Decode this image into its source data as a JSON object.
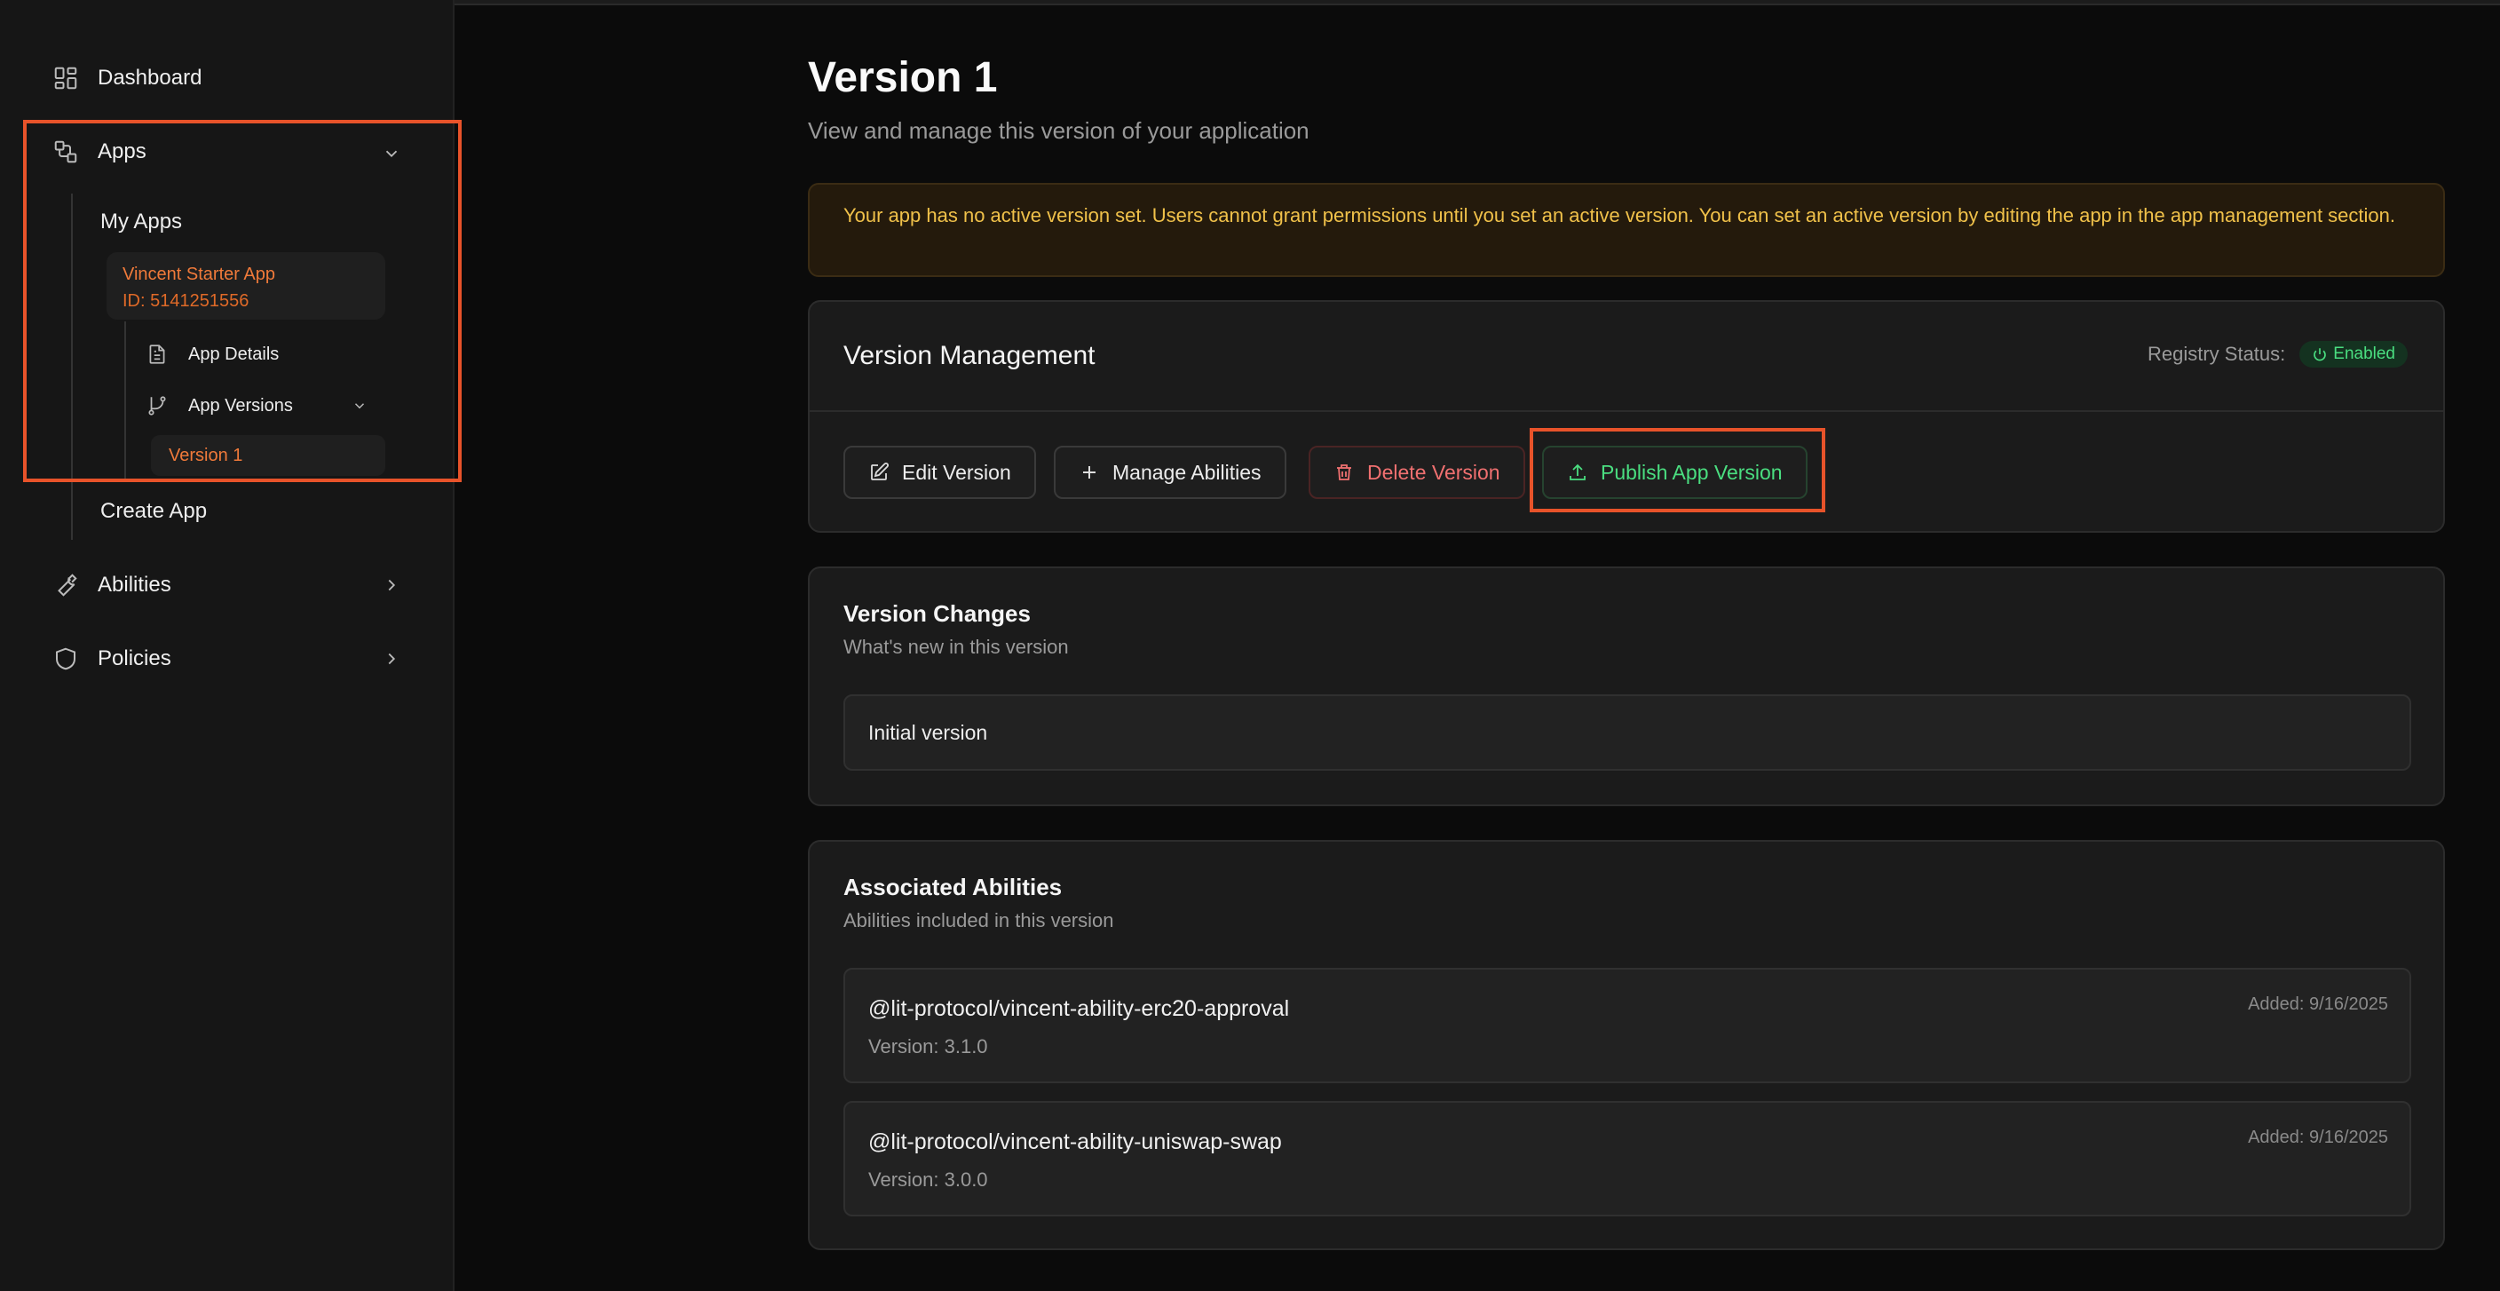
{
  "sidebar": {
    "dashboard": "Dashboard",
    "apps": "Apps",
    "my_apps": "My Apps",
    "app_card": {
      "name": "Vincent Starter App",
      "id": "ID: 5141251556"
    },
    "app_details": "App Details",
    "app_versions": "App Versions",
    "version_item": "Version 1",
    "create_app": "Create App",
    "abilities": "Abilities",
    "policies": "Policies"
  },
  "header": {
    "title": "Version 1",
    "subtitle": "View and manage this version of your application"
  },
  "alert": {
    "text": "Your app has no active version set. Users cannot grant permissions until you set an active version. You can set an active version by editing the app in the app management section."
  },
  "version_management": {
    "title": "Version Management",
    "registry_label": "Registry Status:",
    "registry_status": "Enabled",
    "buttons": {
      "edit": "Edit Version",
      "manage": "Manage Abilities",
      "delete": "Delete Version",
      "publish": "Publish App Version"
    }
  },
  "version_changes": {
    "title": "Version Changes",
    "subtitle": "What's new in this version",
    "content": "Initial version"
  },
  "associated_abilities": {
    "title": "Associated Abilities",
    "subtitle": "Abilities included in this version",
    "items": [
      {
        "name": "@lit-protocol/vincent-ability-erc20-approval",
        "version": "Version: 3.1.0",
        "added": "Added: 9/16/2025"
      },
      {
        "name": "@lit-protocol/vincent-ability-uniswap-swap",
        "version": "Version: 3.0.0",
        "added": "Added: 9/16/2025"
      }
    ]
  },
  "colors": {
    "accent_orange": "#f07a3a",
    "highlight_box": "#e8532a",
    "success_green": "#4ade80",
    "danger_red": "#f07070",
    "warning_yellow": "#f0c14a"
  }
}
